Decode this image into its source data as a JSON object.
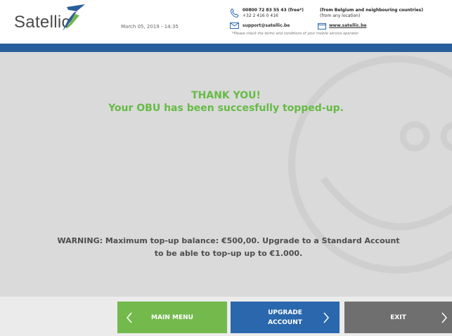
{
  "header": {
    "brand": "Satellic",
    "date": "March 05, 2019 - 14:35",
    "phone_line1": "00800 72 83 55 43 (free*)",
    "phone_line2": "+32 2 416 0 416",
    "region_line1": "(from Belgium and neighbouring countries)",
    "region_line2": "(from any location)",
    "email": "support@satellic.be",
    "website": "www.satellic.be",
    "note": "*Please check the terms and conditions of your mobile service operator."
  },
  "main": {
    "title": "THANK YOU!",
    "subtitle": "Your OBU has been succesfully topped-up.",
    "warning_line1": "WARNING: Maximum top-up balance: €500,00. Upgrade to a Standard Account",
    "warning_line2": "to be able to top-up up to €1.000."
  },
  "footer": {
    "main_menu": "MAIN MENU",
    "upgrade_line1": "UPGRADE",
    "upgrade_line2": "ACCOUNT",
    "exit": "EXIT"
  },
  "colors": {
    "accent_green": "#66bb45",
    "brand_blue": "#2a5e9a",
    "button_green": "#73b94c",
    "button_blue": "#2a67ad",
    "button_grey": "#6f6f6f"
  },
  "icons": [
    "satellic-logo-icon",
    "phone-icon",
    "mail-icon",
    "web-icon",
    "smiley-watermark-icon",
    "chevron-left-icon",
    "chevron-right-icon"
  ]
}
